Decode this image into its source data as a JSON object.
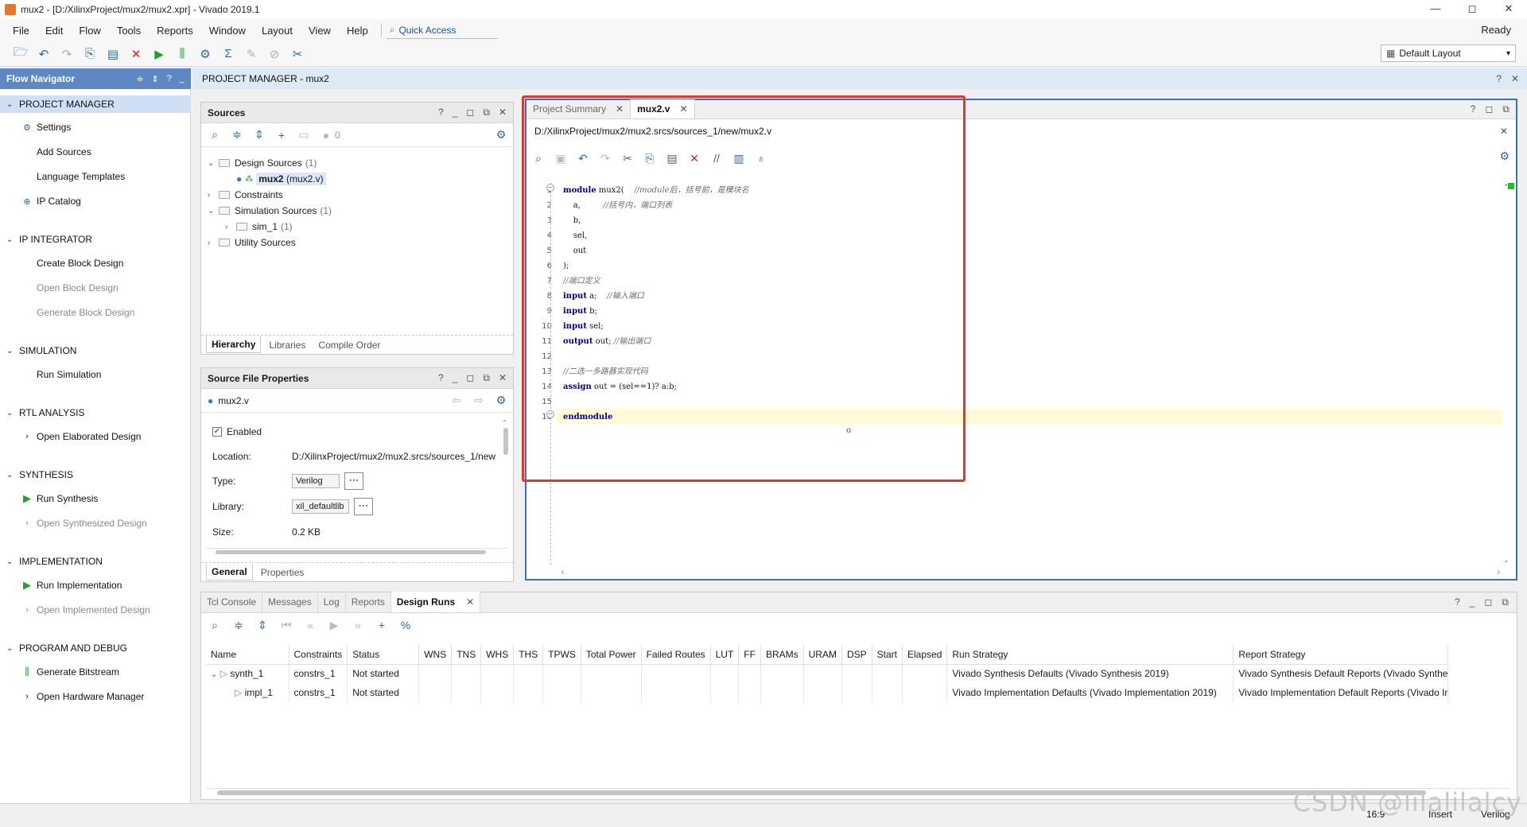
{
  "window": {
    "title": "mux2 - [D:/XilinxProject/mux2/mux2.xpr] - Vivado 2019.1",
    "min": "—",
    "max": "◻",
    "close": "✕"
  },
  "menu": {
    "items": [
      "File",
      "Edit",
      "Flow",
      "Tools",
      "Reports",
      "Window",
      "Layout",
      "View",
      "Help"
    ],
    "quick_access": "Quick Access",
    "status": "Ready"
  },
  "toolbar": {
    "layout_select": "Default Layout"
  },
  "flow_navigator": {
    "title": "Flow Navigator",
    "sections": [
      {
        "label": "PROJECT MANAGER",
        "items": [
          "Settings",
          "Add Sources",
          "Language Templates",
          "IP Catalog"
        ]
      },
      {
        "label": "IP INTEGRATOR",
        "items": [
          "Create Block Design",
          "Open Block Design",
          "Generate Block Design"
        ]
      },
      {
        "label": "SIMULATION",
        "items": [
          "Run Simulation"
        ]
      },
      {
        "label": "RTL ANALYSIS",
        "items": [
          "Open Elaborated Design"
        ]
      },
      {
        "label": "SYNTHESIS",
        "items": [
          "Run Synthesis",
          "Open Synthesized Design"
        ]
      },
      {
        "label": "IMPLEMENTATION",
        "items": [
          "Run Implementation",
          "Open Implemented Design"
        ]
      },
      {
        "label": "PROGRAM AND DEBUG",
        "items": [
          "Generate Bitstream",
          "Open Hardware Manager"
        ]
      }
    ]
  },
  "project_manager": {
    "title": "PROJECT MANAGER - mux2"
  },
  "sources": {
    "title": "Sources",
    "badge_count": "0",
    "tree": {
      "design_sources": "Design Sources",
      "design_sources_count": "(1)",
      "top_module": "mux2",
      "top_module_file": "(mux2.v)",
      "constraints": "Constraints",
      "simulation_sources": "Simulation Sources",
      "simulation_sources_count": "(1)",
      "sim_1": "sim_1",
      "sim_1_count": "(1)",
      "utility_sources": "Utility Sources"
    },
    "tabs": [
      "Hierarchy",
      "Libraries",
      "Compile Order"
    ]
  },
  "file_properties": {
    "title": "Source File Properties",
    "file": "mux2.v",
    "enabled_label": "Enabled",
    "location_label": "Location:",
    "location_value": "D:/XilinxProject/mux2/mux2.srcs/sources_1/new",
    "type_label": "Type:",
    "type_value": "Verilog",
    "library_label": "Library:",
    "library_value": "xil_defaultlib",
    "size_label": "Size:",
    "size_value": "0.2 KB",
    "tabs": [
      "General",
      "Properties"
    ]
  },
  "editor": {
    "tabs": [
      "Project Summary",
      "mux2.v"
    ],
    "path": "D:/XilinxProject/mux2/mux2.srcs/sources_1/new/mux2.v",
    "line_numbers": [
      "1",
      "2",
      "3",
      "4",
      "5",
      "6",
      "7",
      "8",
      "9",
      "10",
      "11",
      "12",
      "13",
      "14",
      "15",
      "16"
    ],
    "code": {
      "l1_kw": "module",
      "l1_rest": " mux2(",
      "l1_cm": "    //module后，括号前，是模块名",
      "l2": "    a,",
      "l2_cm": "         //括号内，端口列表",
      "l3": "    b,",
      "l4": "    sel,",
      "l5": "    out",
      "l6": ");",
      "l7_cm": "//端口定义",
      "l8_kw": "input",
      "l8_rest": " a;",
      "l8_cm": "    //输入端口",
      "l9_kw": "input",
      "l9_rest": " b;",
      "l10_kw": "input",
      "l10_rest": " sel;",
      "l11_kw": "output",
      "l11_rest": " out;",
      "l11_cm": " //输出端口",
      "l13_cm": "//二选一多路器实现代码",
      "l14_kw": "assign",
      "l14_rest": " out = (sel==1)? a:b;",
      "l16_kw": "endmodule"
    },
    "marker": "o"
  },
  "bottom": {
    "tabs": [
      "Tcl Console",
      "Messages",
      "Log",
      "Reports",
      "Design Runs"
    ],
    "columns": [
      "Name",
      "Constraints",
      "Status",
      "WNS",
      "TNS",
      "WHS",
      "THS",
      "TPWS",
      "Total Power",
      "Failed Routes",
      "LUT",
      "FF",
      "BRAMs",
      "URAM",
      "DSP",
      "Start",
      "Elapsed",
      "Run Strategy",
      "Report Strategy"
    ],
    "rows": [
      {
        "name": "synth_1",
        "constraints": "constrs_1",
        "status": "Not started",
        "run_strategy": "Vivado Synthesis Defaults (Vivado Synthesis 2019)",
        "report_strategy": "Vivado Synthesis Default Reports (Vivado Synthes"
      },
      {
        "name": "impl_1",
        "constraints": "constrs_1",
        "status": "Not started",
        "run_strategy": "Vivado Implementation Defaults (Vivado Implementation 2019)",
        "report_strategy": "Vivado Implementation Default Reports (Vivado In"
      }
    ]
  },
  "statusbar": {
    "position": "16:9",
    "mode": "Insert",
    "language": "Verilog"
  },
  "watermark": "CSDN @lilalilalcy",
  "colors": {
    "nav_header": "#5e88c4",
    "editor_border": "#3a6fc9",
    "highlight_rect": "#e0392b",
    "keyword": "#00008b"
  }
}
